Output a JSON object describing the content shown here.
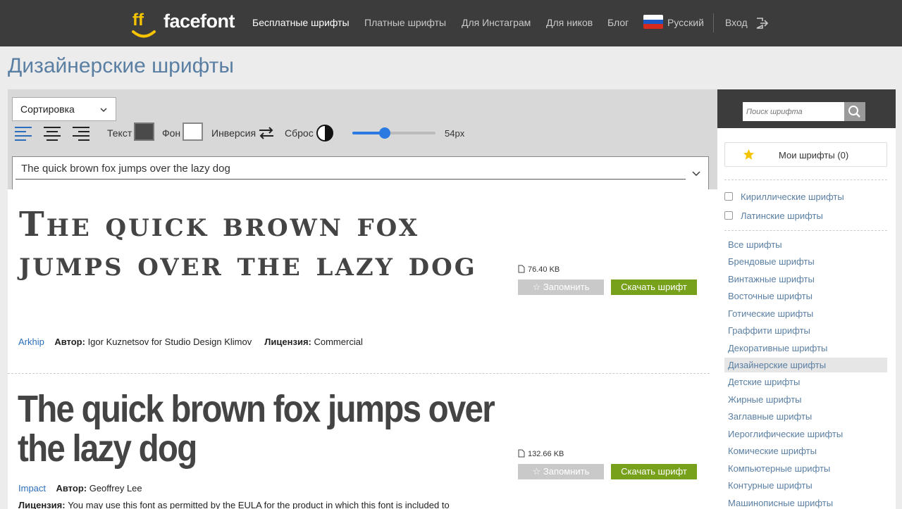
{
  "header": {
    "logo_text": "facefont",
    "nav": [
      {
        "label": "Бесплатные шрифты",
        "active": true
      },
      {
        "label": "Платные шрифты"
      },
      {
        "label": "Для Инстаграм"
      },
      {
        "label": "Для ников"
      },
      {
        "label": "Блог"
      }
    ],
    "language": "Русский",
    "login": "Вход"
  },
  "page_title": "Дизайнерские шрифты",
  "toolbar": {
    "sort_label": "Сортировка",
    "text_label": "Текст",
    "bg_label": "Фон",
    "inversion_label": "Инверсия",
    "reset_label": "Сброс",
    "size_value": "54px",
    "size_fraction": 0.39,
    "preview_text": "The quick brown fox jumps over the lazy dog"
  },
  "fonts": [
    {
      "sample": "The quick brown fox jumps over the lazy dog",
      "name": "Arkhip",
      "author_label": "Автор:",
      "author": "Igor Kuznetsov for Studio Design Klimov",
      "license_label": "Лицензия:",
      "license": "Commercial",
      "size": "76.40 KB",
      "save_label": "Запомнить",
      "download_label": "Скачать шрифт"
    },
    {
      "sample": "The quick brown fox jumps over the lazy dog",
      "name": "Impact",
      "author_label": "Автор:",
      "author": "Geoffrey Lee",
      "license_label": "Лицензия:",
      "license": "You may use this font as permitted by the EULA for the product in which this font is included to",
      "size": "132.66 KB",
      "save_label": "Запомнить",
      "download_label": "Скачать шрифт"
    }
  ],
  "sidebar": {
    "search_placeholder": "Поиск шрифта",
    "favorites": "Мои шрифты (0)",
    "filters": [
      "Кириллические шрифты",
      "Латинские шрифты"
    ],
    "categories": [
      "Все шрифты",
      "Брендовые шрифты",
      "Винтажные шрифты",
      "Восточные шрифты",
      "Готические шрифты",
      "Граффити шрифты",
      "Декоративные шрифты",
      "Дизайнерские шрифты",
      "Детские шрифты",
      "Жирные шрифты",
      "Заглавные шрифты",
      "Иероглифические шрифты",
      "Комические шрифты",
      "Компьютерные шрифты",
      "Контурные шрифты",
      "Машинописные шрифты"
    ],
    "active_category": "Дизайнерские шрифты"
  },
  "colors": {
    "header_bg": "#3c3c3c",
    "accent_link": "#5a7fa3",
    "download_green": "#77a01b",
    "logo_yellow": "#f5c400",
    "slider_blue": "#2a7ae2"
  }
}
